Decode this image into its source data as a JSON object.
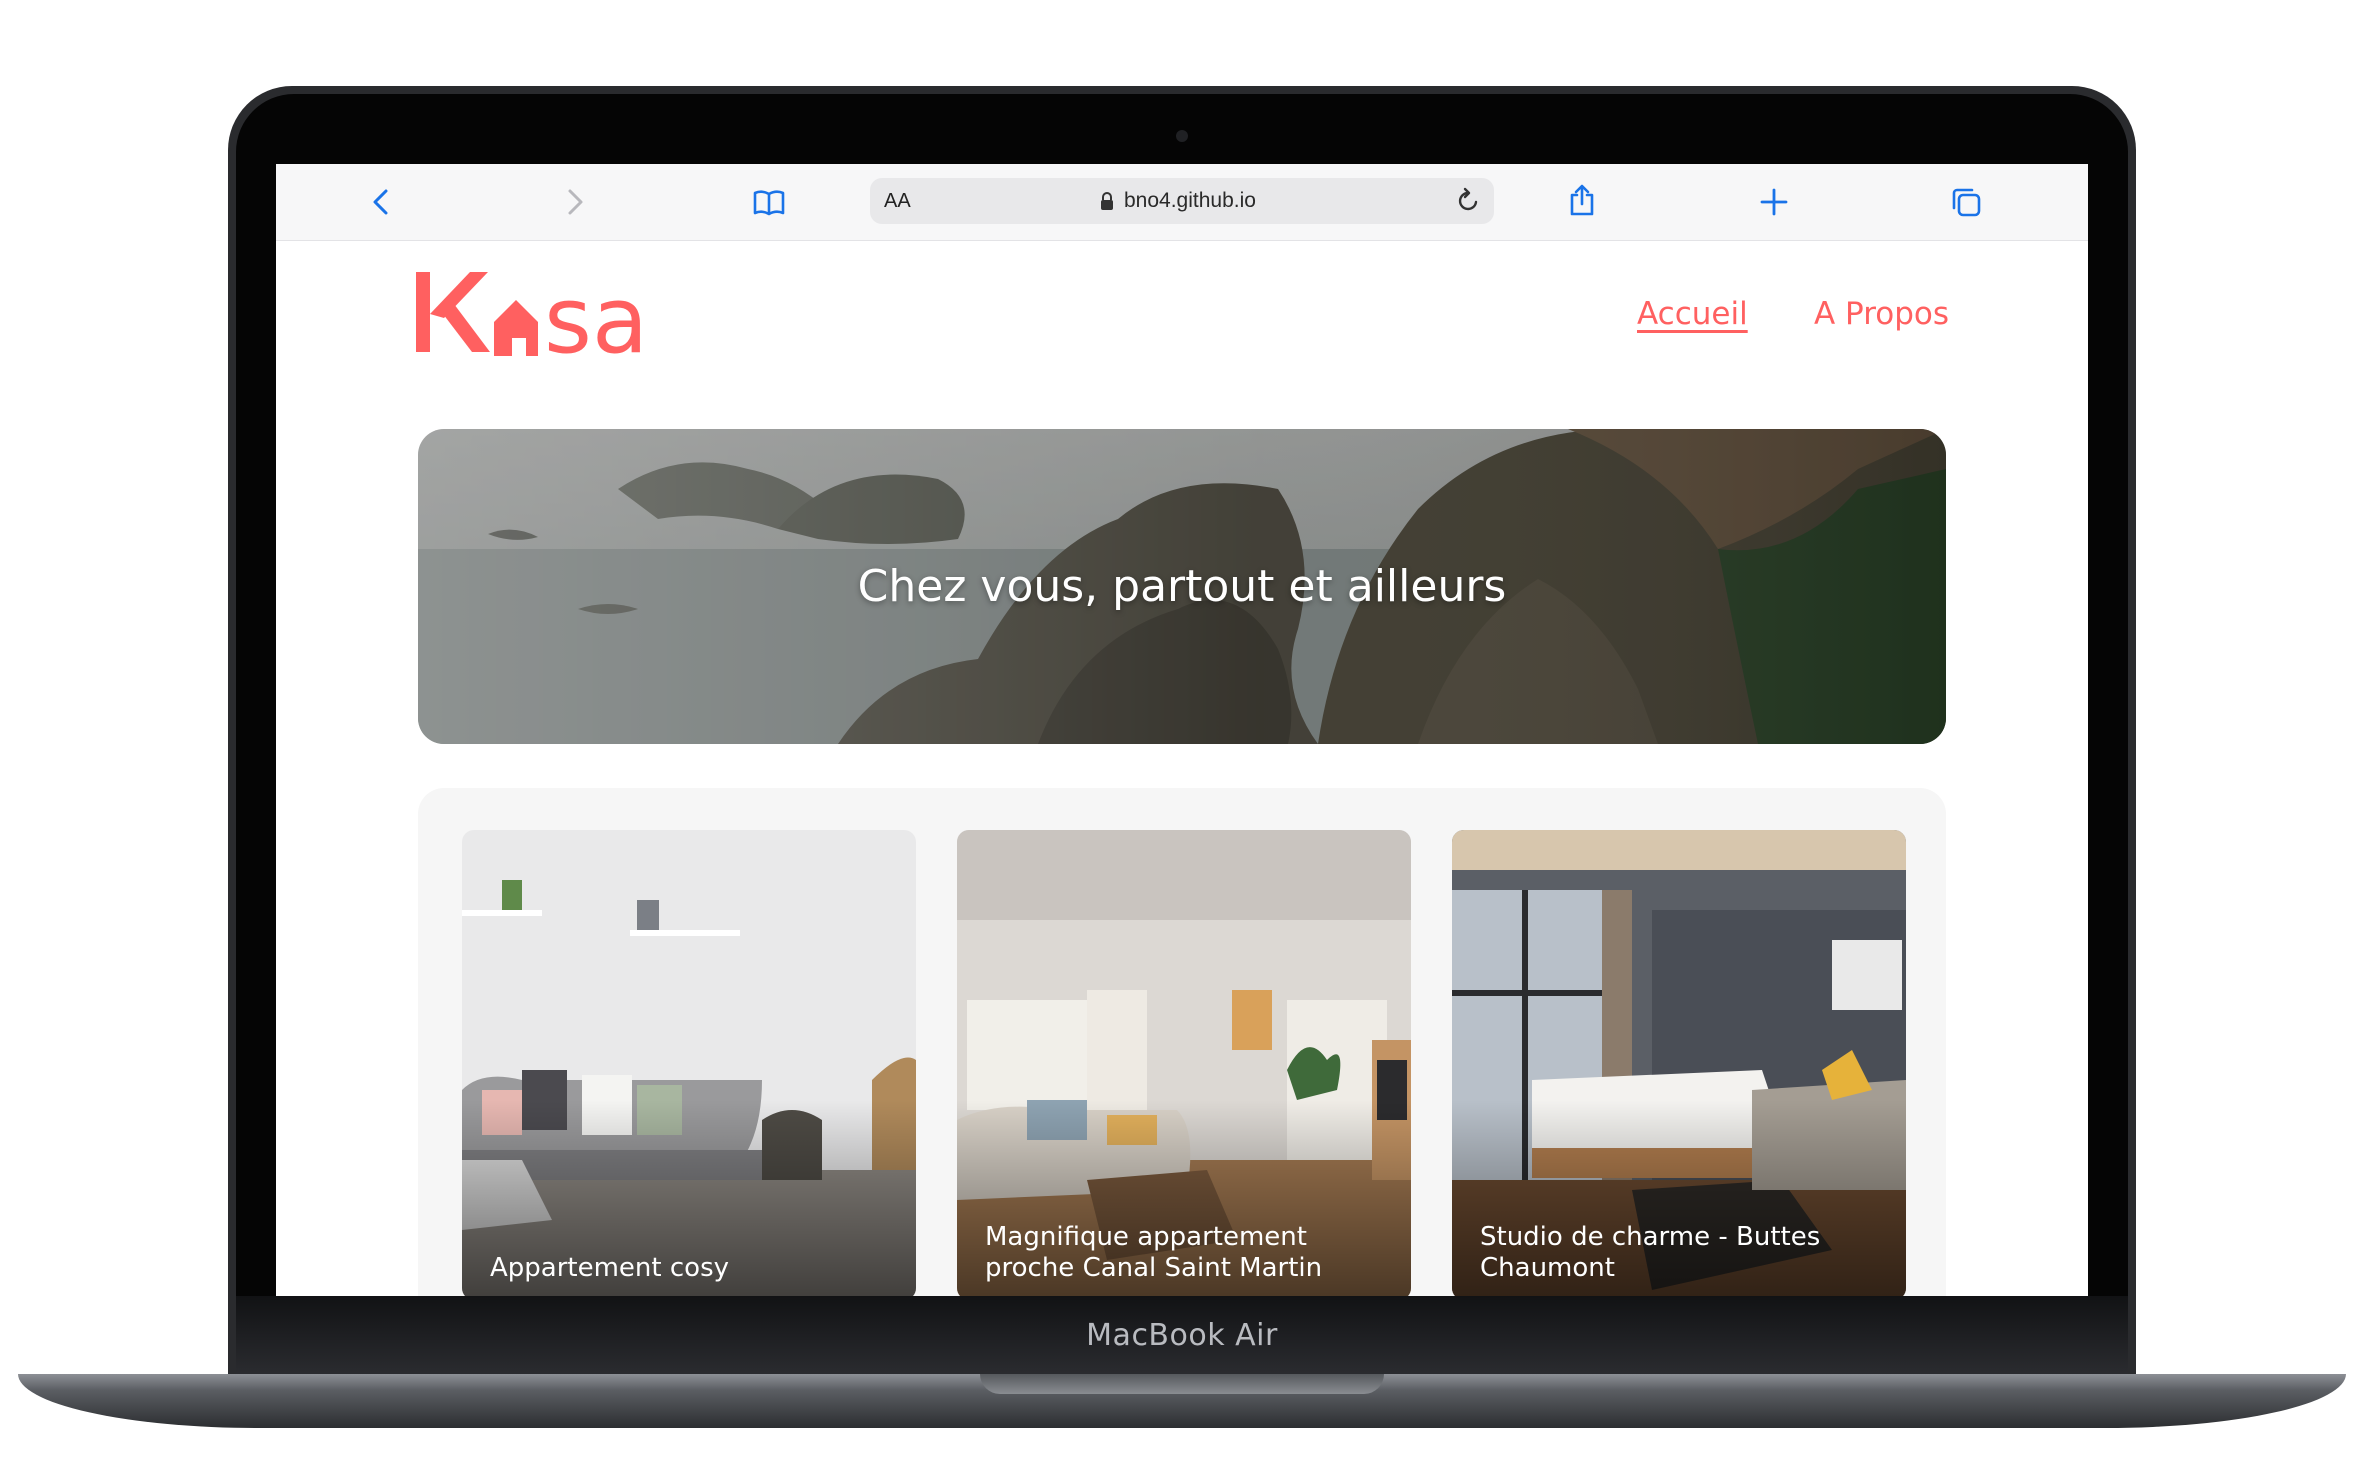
{
  "device": {
    "model_label": "MacBook Air"
  },
  "browser": {
    "text_size_label": "AA",
    "url": "bno4.github.io",
    "icons": [
      "back-icon",
      "forward-icon",
      "bookmarks-icon",
      "lock-icon",
      "reload-icon",
      "share-icon",
      "new-tab-icon",
      "tabs-icon"
    ]
  },
  "site": {
    "logo_text": "Kasa",
    "nav": {
      "home": "Accueil",
      "about": "A Propos"
    },
    "banner_title": "Chez vous, partout et ailleurs",
    "listings": [
      {
        "title": "Appartement cosy"
      },
      {
        "title": "Magnifique appartement proche Canal Saint Martin"
      },
      {
        "title": "Studio de charme - Buttes Chaumont"
      }
    ],
    "colors": {
      "brand": "#ff6060",
      "link": "#ff6060"
    }
  }
}
